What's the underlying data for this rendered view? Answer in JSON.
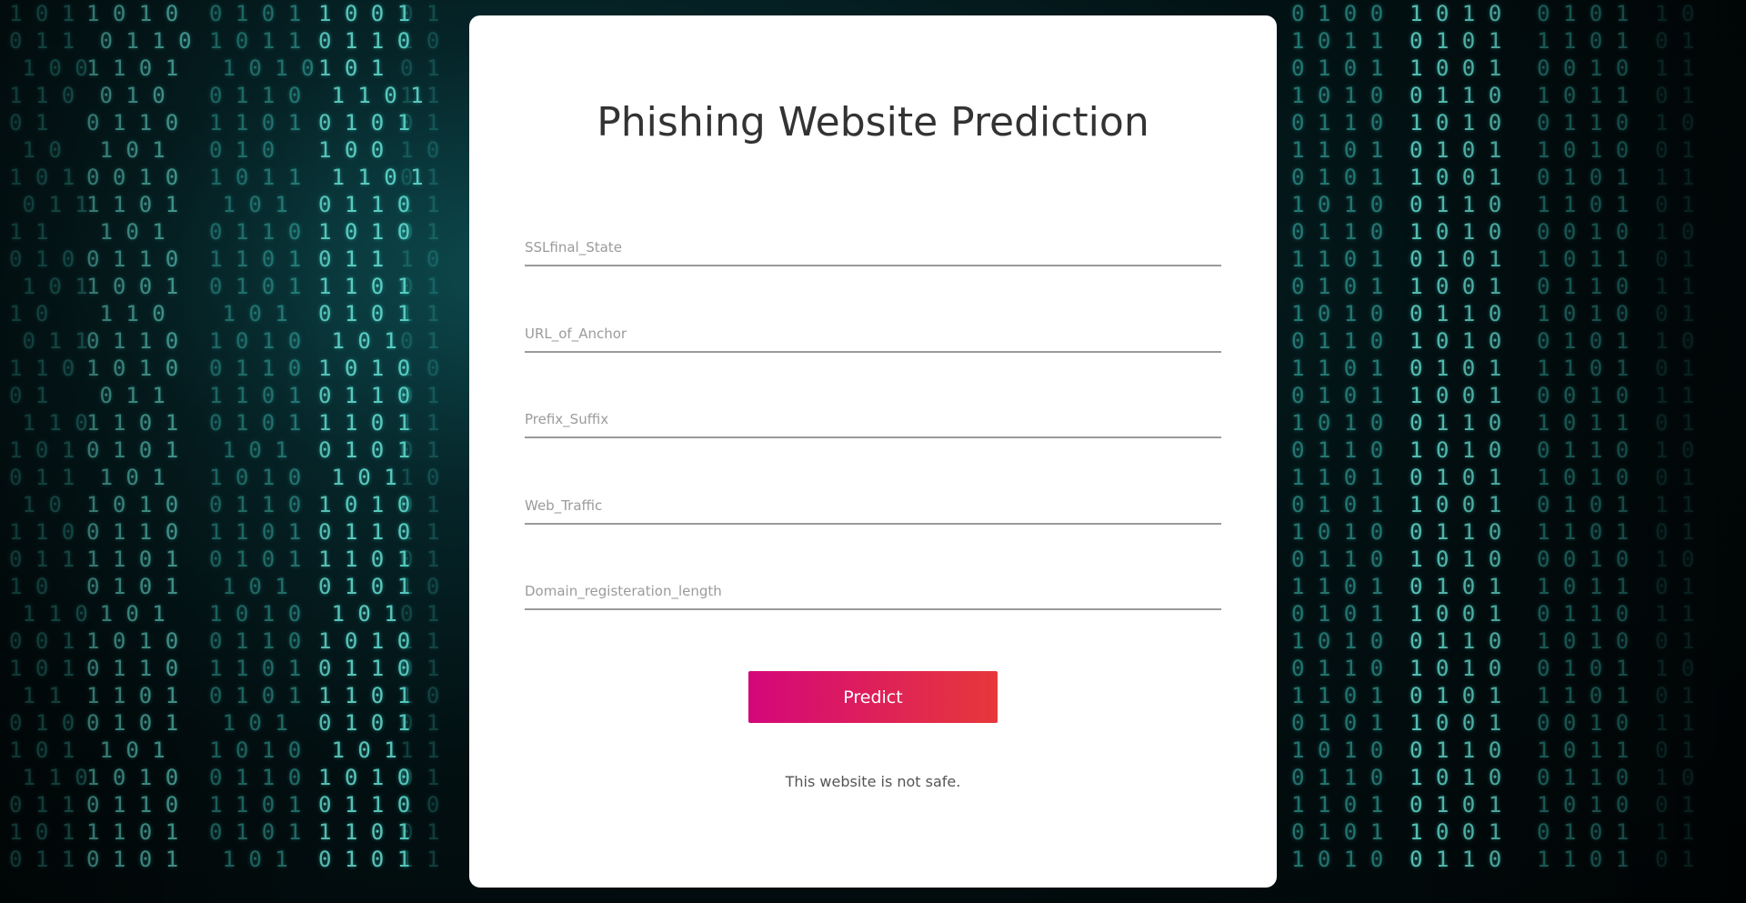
{
  "page": {
    "title": "Phishing Website Prediction"
  },
  "form": {
    "fields": [
      {
        "name": "SSLfinal_State",
        "placeholder": "SSLfinal_State",
        "value": ""
      },
      {
        "name": "URL_of_Anchor",
        "placeholder": "URL_of_Anchor",
        "value": ""
      },
      {
        "name": "Prefix_Suffix",
        "placeholder": "Prefix_Suffix",
        "value": ""
      },
      {
        "name": "Web_Traffic",
        "placeholder": "Web_Traffic",
        "value": ""
      },
      {
        "name": "Domain_registeration_length",
        "placeholder": "Domain_registeration_length",
        "value": ""
      }
    ],
    "submit_label": "Predict"
  },
  "result": {
    "message": "This website is not safe."
  },
  "colors": {
    "button_gradient_start": "#d4077a",
    "button_gradient_end": "#e7383a",
    "background_accent": "#3fc7bd"
  }
}
